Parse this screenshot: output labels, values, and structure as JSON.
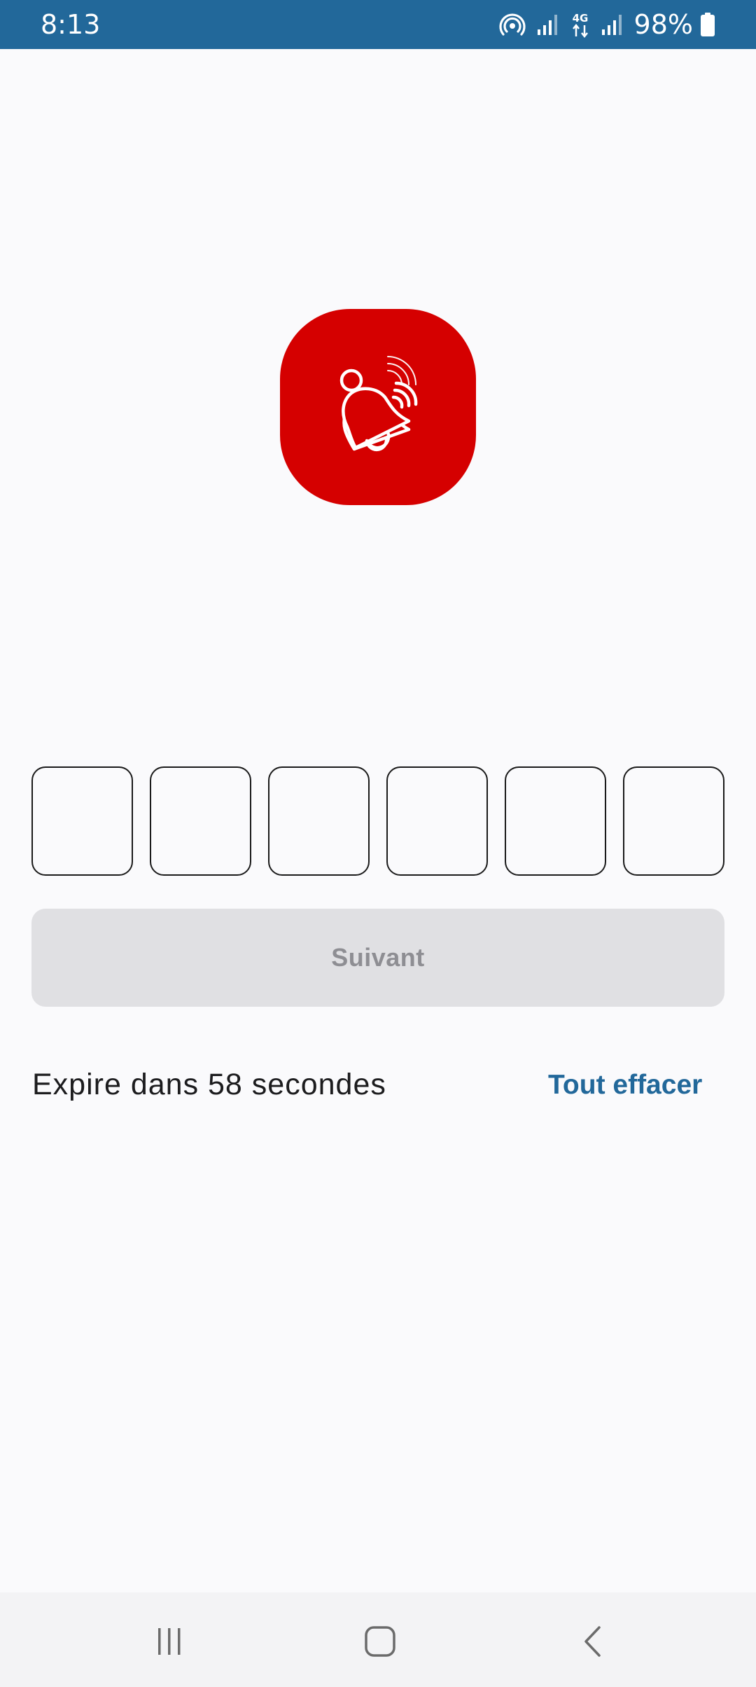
{
  "status_bar": {
    "time": "8:13",
    "battery": "98%",
    "network": "4G",
    "icons": [
      "hotspot-icon",
      "signal-icon",
      "network-4g-icon",
      "signal-icon",
      "battery-icon"
    ]
  },
  "logo": {
    "icon": "bell-ringing-icon",
    "background_color": "#d50000"
  },
  "otp": {
    "digits": [
      "",
      "",
      "",
      "",
      "",
      ""
    ]
  },
  "next_button": {
    "label": "Suivant"
  },
  "footer": {
    "expire_text": "Expire dans 58 secondes",
    "clear_all_label": "Tout effacer"
  },
  "nav_bar": {
    "icons": [
      "recents-icon",
      "home-icon",
      "back-icon"
    ]
  },
  "colors": {
    "accent": "#22689a",
    "brand": "#d50000",
    "button_disabled_bg": "#e0e0e3",
    "button_disabled_text": "#8e8e93"
  }
}
